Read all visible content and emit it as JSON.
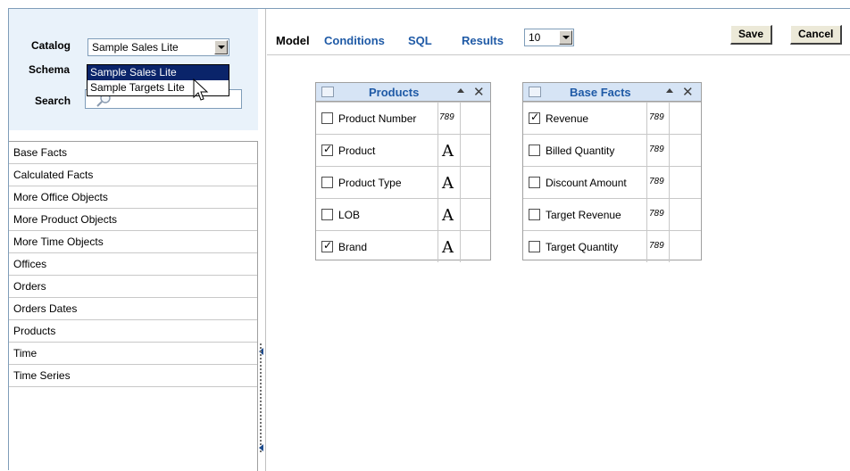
{
  "left_panel": {
    "catalog_label": "Catalog",
    "catalog_value": "Sample Sales Lite",
    "schema_label": "Schema",
    "search_label": "Search",
    "dropdown_options": [
      "Sample Sales Lite",
      "Sample Targets Lite"
    ],
    "subject_areas": [
      "Base Facts",
      "Calculated Facts",
      "More Office Objects",
      "More Product Objects",
      "More Time Objects",
      "Offices",
      "Orders",
      "Orders Dates",
      "Products",
      "Time",
      "Time Series"
    ]
  },
  "toolbar": {
    "tabs": [
      "Model",
      "Conditions",
      "SQL",
      "Results"
    ],
    "active_tab": "Model",
    "results_count": "10",
    "save_label": "Save",
    "cancel_label": "Cancel"
  },
  "tables": [
    {
      "title": "Products",
      "columns": [
        {
          "name": "Product Number",
          "checked": false,
          "type": "number"
        },
        {
          "name": "Product",
          "checked": true,
          "type": "text"
        },
        {
          "name": "Product Type",
          "checked": false,
          "type": "text"
        },
        {
          "name": "LOB",
          "checked": false,
          "type": "text"
        },
        {
          "name": "Brand",
          "checked": true,
          "type": "text"
        }
      ]
    },
    {
      "title": "Base Facts",
      "columns": [
        {
          "name": "Revenue",
          "checked": true,
          "type": "number"
        },
        {
          "name": "Billed Quantity",
          "checked": false,
          "type": "number"
        },
        {
          "name": "Discount Amount",
          "checked": false,
          "type": "number"
        },
        {
          "name": "Target Revenue",
          "checked": false,
          "type": "number"
        },
        {
          "name": "Target Quantity",
          "checked": false,
          "type": "number"
        }
      ]
    }
  ],
  "type_glyphs": {
    "text": "A",
    "number": "789"
  },
  "colors": {
    "accent": "#1f5aa6",
    "panel_bg": "#e9f2fa",
    "header_bg": "#d6e4f5",
    "selection": "#0a246a"
  }
}
